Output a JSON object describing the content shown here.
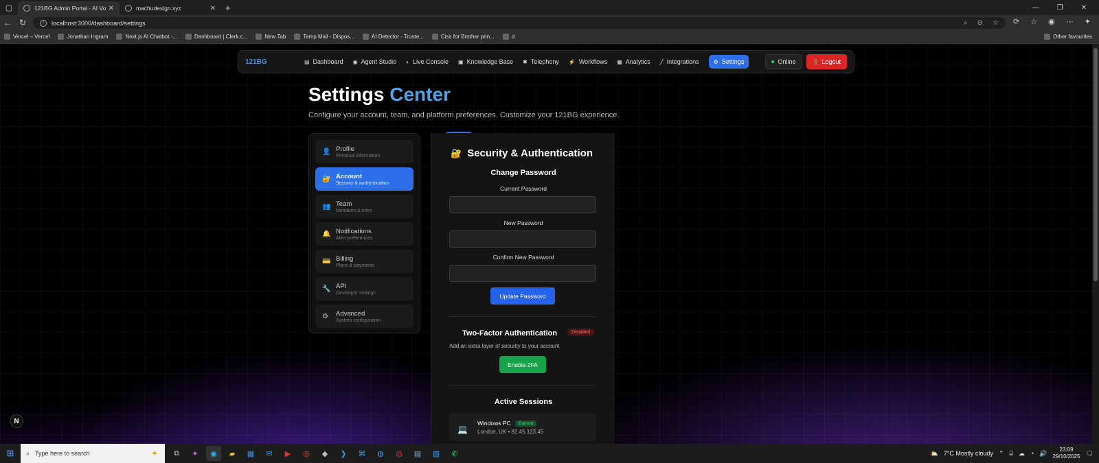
{
  "browser": {
    "tabs": [
      {
        "title": "121BG Admin Portal - AI Voice Ag",
        "active": true
      },
      {
        "title": "machudesign.xyz",
        "active": false
      }
    ],
    "url": "localhost:3000/dashboard/settings",
    "bookmarks": [
      "Vercel – Vercel",
      "Jonathan Ingram",
      "Next.js AI Chatbot -...",
      "Dashboard | Clerk.c...",
      "New Tab",
      "Temp Mail - Dispos...",
      "AI Detector - Truste...",
      "Ciss for Brother prin...",
      "d"
    ],
    "other_favourites": "Other favourites"
  },
  "nav": {
    "logo": "121BG",
    "items": [
      {
        "label": "Dashboard",
        "icon": "chart-icon",
        "glyph": "▤"
      },
      {
        "label": "Agent Studio",
        "icon": "agent-icon",
        "glyph": "◉"
      },
      {
        "label": "Live Console",
        "icon": "console-icon",
        "glyph": "◐"
      },
      {
        "label": "Knowledge Base",
        "icon": "book-icon",
        "glyph": "▣"
      },
      {
        "label": "Telephony",
        "icon": "phone-icon",
        "glyph": "✖"
      },
      {
        "label": "Workflows",
        "icon": "bolt-icon",
        "glyph": "⚡"
      },
      {
        "label": "Analytics",
        "icon": "analytics-icon",
        "glyph": "▦"
      },
      {
        "label": "Integrations",
        "icon": "plug-icon",
        "glyph": "╱"
      },
      {
        "label": "Settings",
        "icon": "gear-icon",
        "glyph": "⚙"
      }
    ],
    "online": "Online",
    "logout": "Logout"
  },
  "header": {
    "title_main": "Settings",
    "title_accent": "Center",
    "subtitle": "Configure your account, team, and platform preferences. Customize your 121BG experience."
  },
  "sidebar": {
    "items": [
      {
        "title": "Profile",
        "desc": "Personal information",
        "glyph": "👤"
      },
      {
        "title": "Account",
        "desc": "Security & authentication",
        "glyph": "🔐"
      },
      {
        "title": "Team",
        "desc": "Members & roles",
        "glyph": "👥"
      },
      {
        "title": "Notifications",
        "desc": "Alert preferences",
        "glyph": "🔔"
      },
      {
        "title": "Billing",
        "desc": "Plans & payments",
        "glyph": "💳"
      },
      {
        "title": "API",
        "desc": "Developer settings",
        "glyph": "🔧"
      },
      {
        "title": "Advanced",
        "desc": "System configuration",
        "glyph": "⚙"
      }
    ]
  },
  "security": {
    "title": "Security & Authentication",
    "change_password": "Change Password",
    "current_password_label": "Current Password",
    "new_password_label": "New Password",
    "confirm_password_label": "Confirm New Password",
    "current_password_value": "",
    "new_password_value": "",
    "confirm_password_value": "",
    "update_button": "Update Password",
    "tfa_title": "Two-Factor Authentication",
    "tfa_status": "Disabled",
    "tfa_desc": "Add an extra layer of security to your account",
    "tfa_button": "Enable 2FA",
    "sessions_title": "Active Sessions",
    "session": {
      "device": "Windows PC",
      "badge": "Current",
      "location": "London, UK • 82.45.123.45"
    }
  },
  "taskbar": {
    "search_placeholder": "Type here to search",
    "weather": "7°C  Mostly cloudy",
    "time": "23:09",
    "date": "29/10/2025"
  }
}
